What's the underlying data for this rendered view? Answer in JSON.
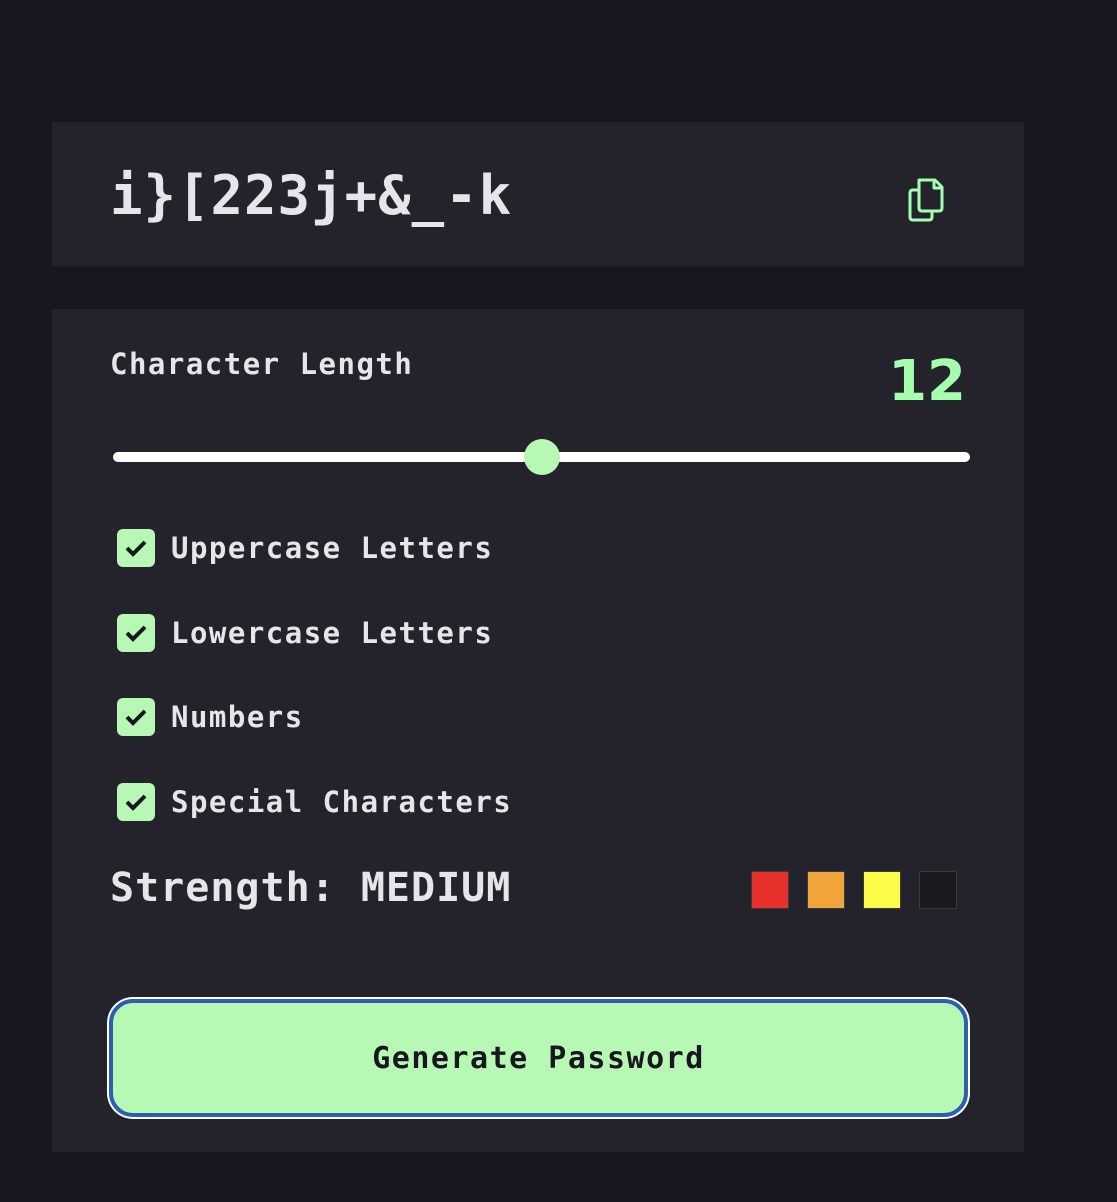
{
  "password": {
    "value": "i}[223j+&_-k",
    "copy_icon": "copy-icon"
  },
  "settings": {
    "length_label": "Character Length",
    "length_value": "12",
    "slider_level": 0.5,
    "options": [
      {
        "label": "Uppercase Letters",
        "checked": true
      },
      {
        "label": "Lowercase Letters",
        "checked": true
      },
      {
        "label": "Numbers",
        "checked": true
      },
      {
        "label": "Special Characters",
        "checked": true
      }
    ],
    "strength_label": "Strength: MEDIUM",
    "strength_colors": [
      "#e8302a",
      "#f0a53a",
      "#fbfc4a",
      "#1b1b1f"
    ],
    "generate_label": "Generate Password"
  },
  "colors": {
    "accent": "#a4ffaf",
    "background": "#18171f",
    "panel": "#24232c"
  }
}
